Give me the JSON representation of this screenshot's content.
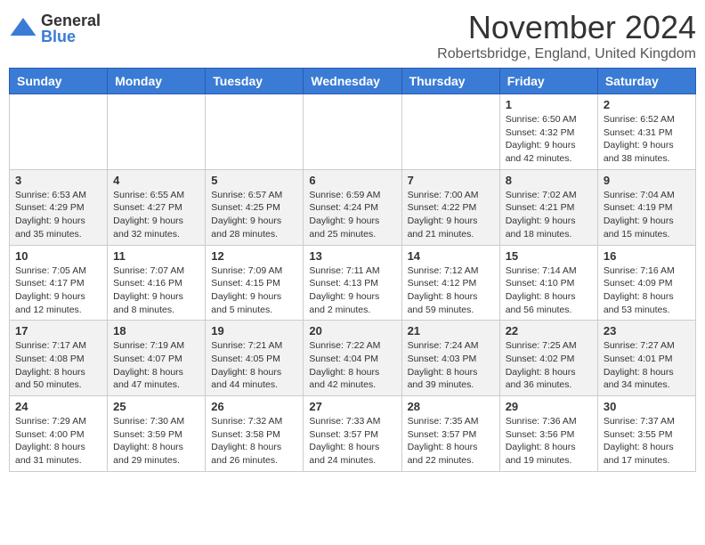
{
  "logo": {
    "general": "General",
    "blue": "Blue"
  },
  "title": "November 2024",
  "location": "Robertsbridge, England, United Kingdom",
  "days_of_week": [
    "Sunday",
    "Monday",
    "Tuesday",
    "Wednesday",
    "Thursday",
    "Friday",
    "Saturday"
  ],
  "weeks": [
    [
      {
        "day": "",
        "info": ""
      },
      {
        "day": "",
        "info": ""
      },
      {
        "day": "",
        "info": ""
      },
      {
        "day": "",
        "info": ""
      },
      {
        "day": "",
        "info": ""
      },
      {
        "day": "1",
        "info": "Sunrise: 6:50 AM\nSunset: 4:32 PM\nDaylight: 9 hours\nand 42 minutes."
      },
      {
        "day": "2",
        "info": "Sunrise: 6:52 AM\nSunset: 4:31 PM\nDaylight: 9 hours\nand 38 minutes."
      }
    ],
    [
      {
        "day": "3",
        "info": "Sunrise: 6:53 AM\nSunset: 4:29 PM\nDaylight: 9 hours\nand 35 minutes."
      },
      {
        "day": "4",
        "info": "Sunrise: 6:55 AM\nSunset: 4:27 PM\nDaylight: 9 hours\nand 32 minutes."
      },
      {
        "day": "5",
        "info": "Sunrise: 6:57 AM\nSunset: 4:25 PM\nDaylight: 9 hours\nand 28 minutes."
      },
      {
        "day": "6",
        "info": "Sunrise: 6:59 AM\nSunset: 4:24 PM\nDaylight: 9 hours\nand 25 minutes."
      },
      {
        "day": "7",
        "info": "Sunrise: 7:00 AM\nSunset: 4:22 PM\nDaylight: 9 hours\nand 21 minutes."
      },
      {
        "day": "8",
        "info": "Sunrise: 7:02 AM\nSunset: 4:21 PM\nDaylight: 9 hours\nand 18 minutes."
      },
      {
        "day": "9",
        "info": "Sunrise: 7:04 AM\nSunset: 4:19 PM\nDaylight: 9 hours\nand 15 minutes."
      }
    ],
    [
      {
        "day": "10",
        "info": "Sunrise: 7:05 AM\nSunset: 4:17 PM\nDaylight: 9 hours\nand 12 minutes."
      },
      {
        "day": "11",
        "info": "Sunrise: 7:07 AM\nSunset: 4:16 PM\nDaylight: 9 hours\nand 8 minutes."
      },
      {
        "day": "12",
        "info": "Sunrise: 7:09 AM\nSunset: 4:15 PM\nDaylight: 9 hours\nand 5 minutes."
      },
      {
        "day": "13",
        "info": "Sunrise: 7:11 AM\nSunset: 4:13 PM\nDaylight: 9 hours\nand 2 minutes."
      },
      {
        "day": "14",
        "info": "Sunrise: 7:12 AM\nSunset: 4:12 PM\nDaylight: 8 hours\nand 59 minutes."
      },
      {
        "day": "15",
        "info": "Sunrise: 7:14 AM\nSunset: 4:10 PM\nDaylight: 8 hours\nand 56 minutes."
      },
      {
        "day": "16",
        "info": "Sunrise: 7:16 AM\nSunset: 4:09 PM\nDaylight: 8 hours\nand 53 minutes."
      }
    ],
    [
      {
        "day": "17",
        "info": "Sunrise: 7:17 AM\nSunset: 4:08 PM\nDaylight: 8 hours\nand 50 minutes."
      },
      {
        "day": "18",
        "info": "Sunrise: 7:19 AM\nSunset: 4:07 PM\nDaylight: 8 hours\nand 47 minutes."
      },
      {
        "day": "19",
        "info": "Sunrise: 7:21 AM\nSunset: 4:05 PM\nDaylight: 8 hours\nand 44 minutes."
      },
      {
        "day": "20",
        "info": "Sunrise: 7:22 AM\nSunset: 4:04 PM\nDaylight: 8 hours\nand 42 minutes."
      },
      {
        "day": "21",
        "info": "Sunrise: 7:24 AM\nSunset: 4:03 PM\nDaylight: 8 hours\nand 39 minutes."
      },
      {
        "day": "22",
        "info": "Sunrise: 7:25 AM\nSunset: 4:02 PM\nDaylight: 8 hours\nand 36 minutes."
      },
      {
        "day": "23",
        "info": "Sunrise: 7:27 AM\nSunset: 4:01 PM\nDaylight: 8 hours\nand 34 minutes."
      }
    ],
    [
      {
        "day": "24",
        "info": "Sunrise: 7:29 AM\nSunset: 4:00 PM\nDaylight: 8 hours\nand 31 minutes."
      },
      {
        "day": "25",
        "info": "Sunrise: 7:30 AM\nSunset: 3:59 PM\nDaylight: 8 hours\nand 29 minutes."
      },
      {
        "day": "26",
        "info": "Sunrise: 7:32 AM\nSunset: 3:58 PM\nDaylight: 8 hours\nand 26 minutes."
      },
      {
        "day": "27",
        "info": "Sunrise: 7:33 AM\nSunset: 3:57 PM\nDaylight: 8 hours\nand 24 minutes."
      },
      {
        "day": "28",
        "info": "Sunrise: 7:35 AM\nSunset: 3:57 PM\nDaylight: 8 hours\nand 22 minutes."
      },
      {
        "day": "29",
        "info": "Sunrise: 7:36 AM\nSunset: 3:56 PM\nDaylight: 8 hours\nand 19 minutes."
      },
      {
        "day": "30",
        "info": "Sunrise: 7:37 AM\nSunset: 3:55 PM\nDaylight: 8 hours\nand 17 minutes."
      }
    ]
  ]
}
